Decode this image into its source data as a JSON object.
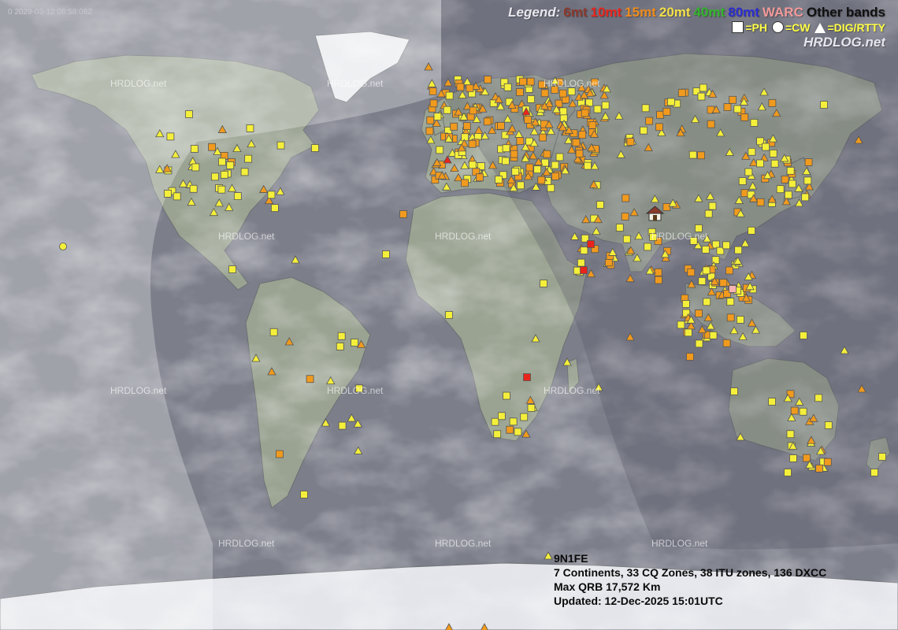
{
  "timestamp": "0 2029-03-12 08:58:08Z",
  "legend": {
    "label": "Legend:",
    "bands": [
      {
        "label": "6mt",
        "color": "#8b3a2e"
      },
      {
        "label": "10mt",
        "color": "#e8251b"
      },
      {
        "label": "15mt",
        "color": "#f08b1a"
      },
      {
        "label": "20mt",
        "color": "#f3e04a"
      },
      {
        "label": "40mt",
        "color": "#32b52a"
      },
      {
        "label": "80mt",
        "color": "#2d2dd0"
      },
      {
        "label": "WARC",
        "color": "#f29a9a"
      },
      {
        "label": "Other bands",
        "color": "#111111"
      }
    ],
    "modes": [
      {
        "shape": "square",
        "label": "=PH"
      },
      {
        "shape": "circle",
        "label": "=CW"
      },
      {
        "shape": "triangle",
        "label": "=DIG/RTTY"
      }
    ],
    "brand": "HRDLOG.net"
  },
  "watermark": "HRDLOG.net",
  "info": {
    "callsign": "9N1FE",
    "summary": "7 Continents, 33 CQ Zones, 38 ITU zones, 136 DXCC",
    "max_qrb": "Max QRB 17,572 Km",
    "updated": "Updated: 12-Dec-2025 15:01UTC"
  },
  "colors": {
    "ocean": "#7f818c",
    "land": "#9aa392",
    "daylight": "#c9cad2",
    "ice": "#e8eaee"
  },
  "icons": [
    "home-station-icon",
    "qso-square-marker",
    "qso-triangle-marker",
    "qso-circle-marker"
  ]
}
